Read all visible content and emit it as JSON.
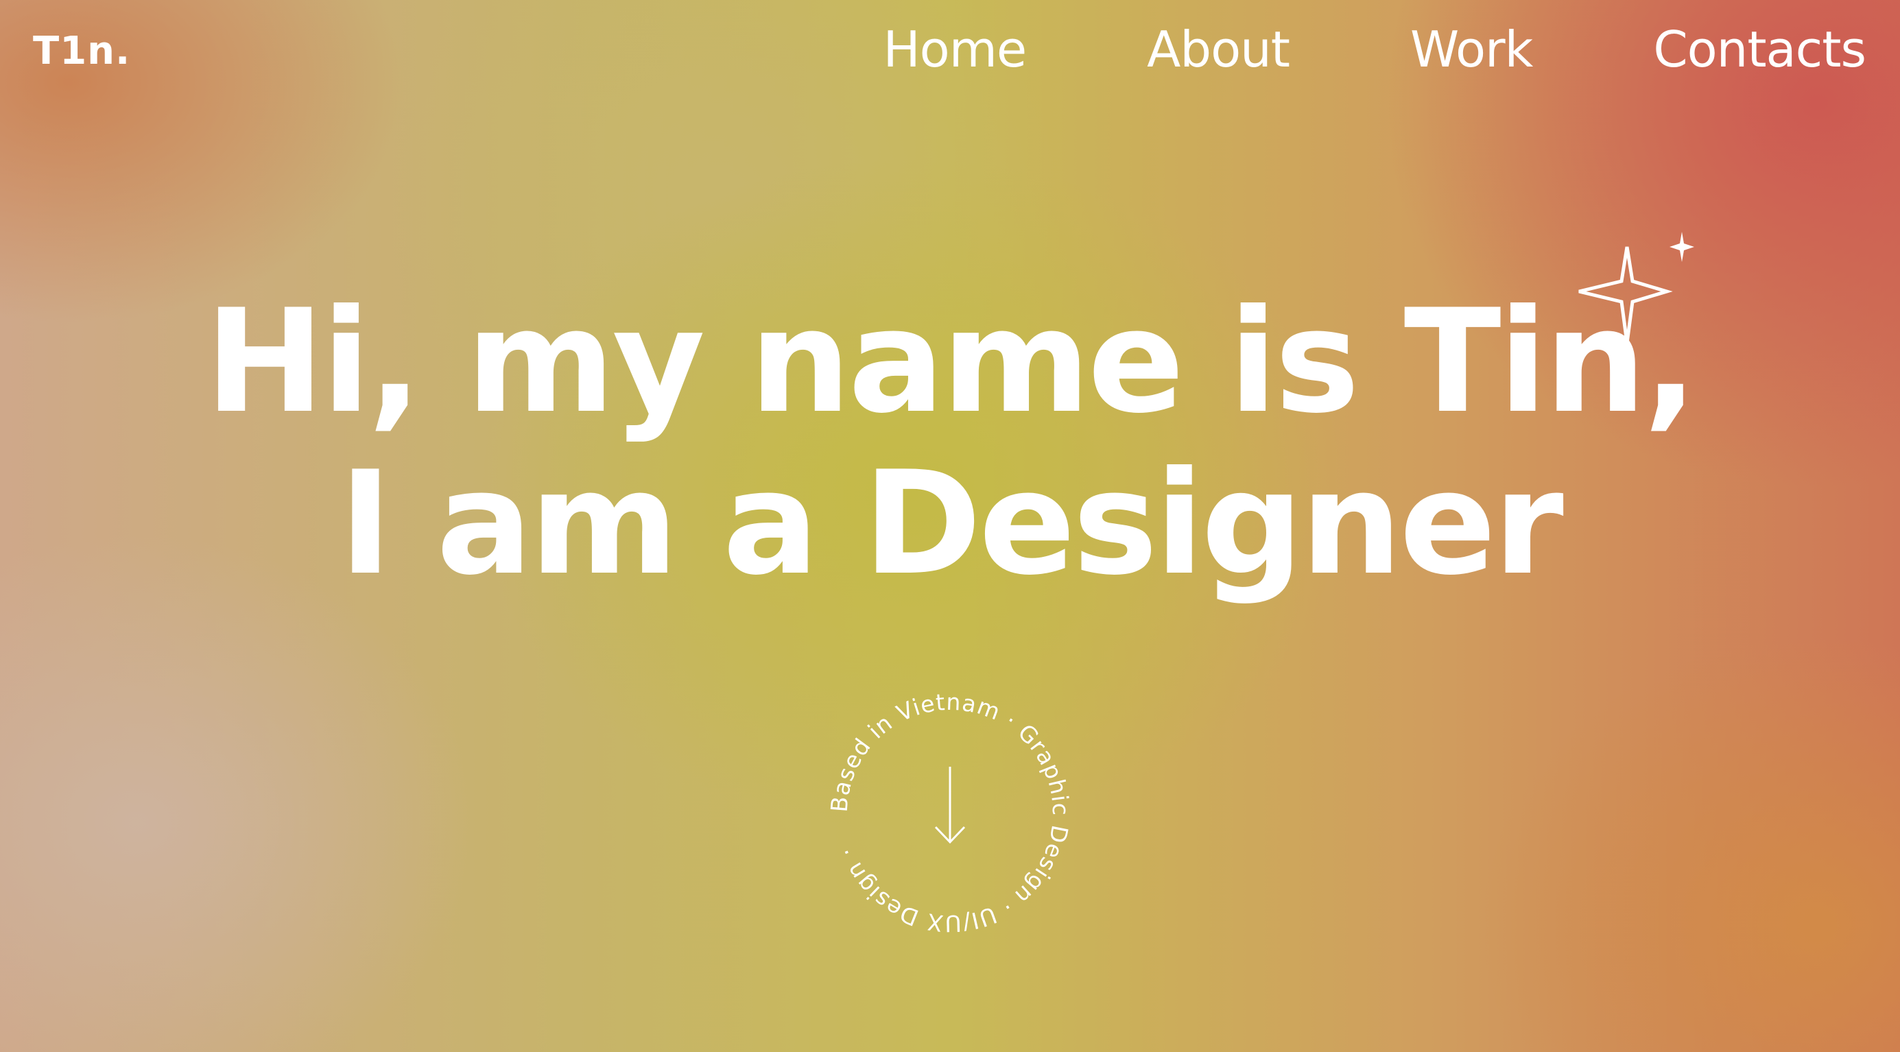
{
  "header": {
    "logo": "T1n.",
    "nav": [
      "Home",
      "About",
      "Work",
      "Contacts"
    ]
  },
  "hero": {
    "line1": "Hi, my name is Tin,",
    "line2": "I am a Designer"
  },
  "badge": {
    "circular_text": "Based in Vietnam · Graphic Design · UI/UX Design · ",
    "icon": "arrow-down-icon"
  },
  "decoration": {
    "icon": "sparkle-icon"
  },
  "colors": {
    "text": "#ffffff",
    "red_accent": "#cd5852",
    "yellow_accent": "#c4ba46",
    "orange_accent": "#d28c46"
  }
}
